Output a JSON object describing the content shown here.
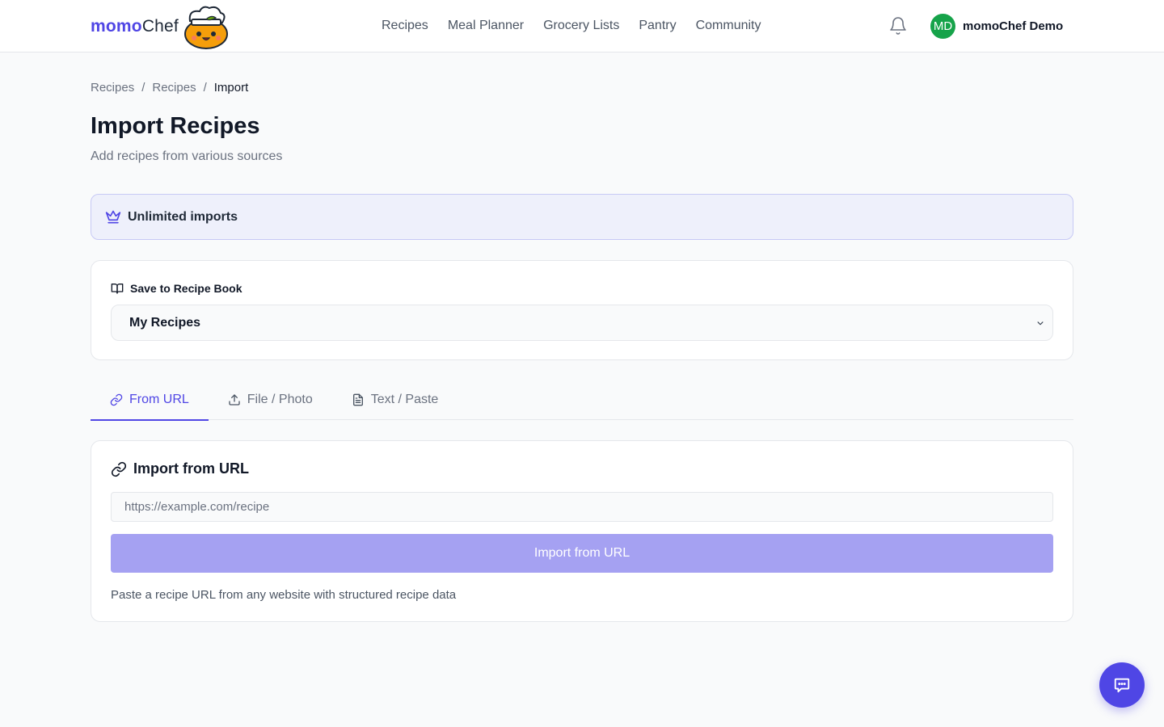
{
  "header": {
    "logo_primary": "momo",
    "logo_secondary": "Chef",
    "nav": [
      "Recipes",
      "Meal Planner",
      "Grocery Lists",
      "Pantry",
      "Community"
    ],
    "user": {
      "initials": "MD",
      "name": "momoChef Demo"
    },
    "icons": {
      "notifications": "bell-icon"
    }
  },
  "breadcrumb": [
    "Recipes",
    "Recipes",
    "Import"
  ],
  "page": {
    "title": "Import Recipes",
    "subtitle": "Add recipes from various sources"
  },
  "banner": {
    "icon": "crown-icon",
    "text": "Unlimited imports"
  },
  "recipe_book": {
    "icon": "book-open-icon",
    "label": "Save to Recipe Book",
    "selected": "My Recipes"
  },
  "tabs": [
    {
      "icon": "link-icon",
      "label": "From URL",
      "active": true
    },
    {
      "icon": "upload-icon",
      "label": "File / Photo",
      "active": false
    },
    {
      "icon": "file-text-icon",
      "label": "Text / Paste",
      "active": false
    }
  ],
  "url_import": {
    "heading": "Import from URL",
    "input_value": "",
    "input_placeholder": "https://example.com/recipe",
    "button_label": "Import from URL",
    "help": "Paste a recipe URL from any website with structured recipe data"
  },
  "colors": {
    "accent": "#5046e5",
    "button_disabled": "#a5a1f2",
    "avatar": "#16a34a",
    "banner_bg": "#eef0fb"
  },
  "chat": {
    "icon": "chat-bubble-icon"
  }
}
